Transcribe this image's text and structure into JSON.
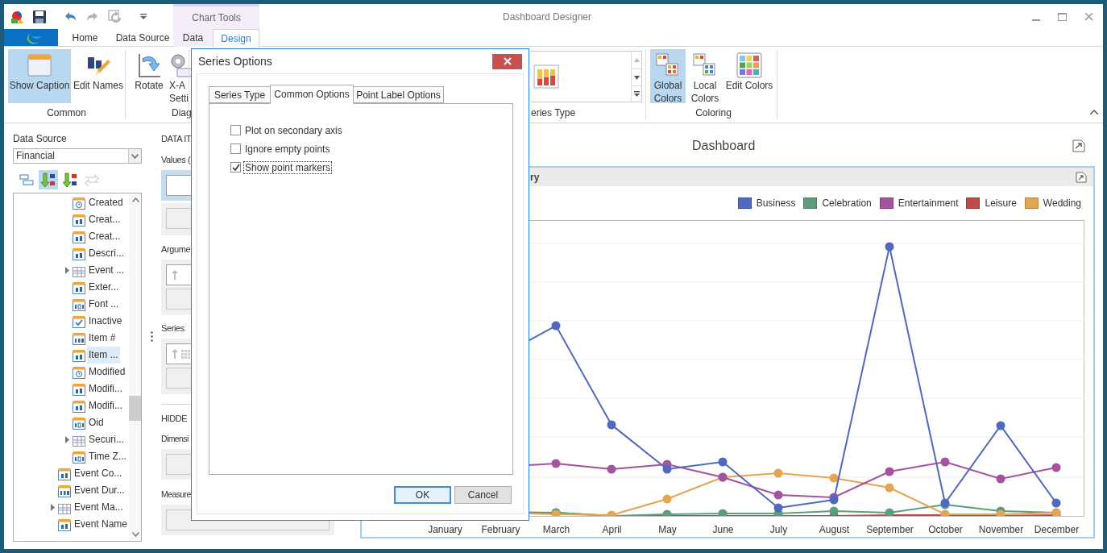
{
  "window": {
    "title": "Dashboard Designer"
  },
  "context_group": {
    "label": "Chart Tools"
  },
  "tabs": [
    {
      "label": "Home",
      "selected": false,
      "contextual": false
    },
    {
      "label": "Data Source",
      "selected": false,
      "contextual": false
    },
    {
      "label": "Data",
      "selected": false,
      "contextual": true
    },
    {
      "label": "Design",
      "selected": true,
      "contextual": true
    }
  ],
  "ribbon": [
    {
      "kind": "buttons",
      "label": "Common",
      "buttons": [
        {
          "lines": [
            "Show Caption"
          ],
          "selected": true
        },
        {
          "lines": [
            "Edit Names"
          ],
          "selected": false
        }
      ]
    },
    {
      "kind": "buttons",
      "label": "Diag",
      "buttons": [
        {
          "lines": [
            "Rotate"
          ],
          "selected": false
        },
        {
          "lines": [
            "X-A",
            "Setti"
          ],
          "selected": false
        }
      ]
    },
    {
      "kind": "gallery",
      "label": "eries Type"
    },
    {
      "kind": "buttons",
      "label": "Coloring",
      "buttons": [
        {
          "lines": [
            "Global",
            "Colors"
          ],
          "selected": true
        },
        {
          "lines": [
            "Local",
            "Colors"
          ],
          "selected": false
        },
        {
          "lines": [
            "Edit Colors"
          ],
          "selected": false
        }
      ]
    }
  ],
  "data_source": {
    "label": "Data Source",
    "value": "Financial"
  },
  "sort_buttons": [
    {
      "selected": false,
      "disabled": false
    },
    {
      "selected": true,
      "disabled": false
    },
    {
      "selected": false,
      "disabled": false
    },
    {
      "selected": false,
      "disabled": true
    }
  ],
  "field_tree": {
    "children_of_scrolled_parent": [
      {
        "label": "Created",
        "kind": "date",
        "selected": false
      },
      {
        "label": "Creat...",
        "kind": "text",
        "selected": false
      },
      {
        "label": "Creat...",
        "kind": "text",
        "selected": false
      },
      {
        "label": "Descri...",
        "kind": "text",
        "selected": false
      },
      {
        "label": "Event ...",
        "kind": "table",
        "selected": false,
        "expanded": false
      },
      {
        "label": "Exter...",
        "kind": "text",
        "selected": false
      },
      {
        "label": "Font ...",
        "kind": "number",
        "selected": false
      },
      {
        "label": "Inactive",
        "kind": "bool",
        "selected": false
      },
      {
        "label": "Item #",
        "kind": "integer",
        "selected": false
      },
      {
        "label": "Item ...",
        "kind": "text",
        "selected": true
      },
      {
        "label": "Modified",
        "kind": "date",
        "selected": false
      },
      {
        "label": "Modifi...",
        "kind": "text",
        "selected": false
      },
      {
        "label": "Modifi...",
        "kind": "text",
        "selected": false
      },
      {
        "label": "Oid",
        "kind": "number",
        "selected": false
      },
      {
        "label": "Securi...",
        "kind": "table",
        "selected": false,
        "expanded": false
      },
      {
        "label": "Time Z...",
        "kind": "number",
        "selected": false
      }
    ],
    "items": [
      {
        "label": "Event Co...",
        "kind": "text",
        "selected": false
      },
      {
        "label": "Event Dur...",
        "kind": "integer",
        "selected": false
      },
      {
        "label": "Event Ma...",
        "kind": "table",
        "selected": false,
        "expanded": false
      },
      {
        "label": "Event Name",
        "kind": "text",
        "selected": false
      }
    ]
  },
  "data_items": {
    "heading": "DATA IT",
    "zones": [
      {
        "kind": "values",
        "label": "Values (",
        "selected": true
      },
      {
        "kind": "argument",
        "label": "Argume",
        "selected": false
      },
      {
        "kind": "series",
        "label": "Series",
        "selected": false
      }
    ]
  },
  "hidden_items": {
    "heading": "HIDDE",
    "zones": [
      {
        "label": "Dimensi"
      },
      {
        "label": "Measure"
      }
    ]
  },
  "dashboard": {
    "title": "Dashboard",
    "item": {
      "caption": "ry",
      "legend": [
        {
          "label": "Business",
          "color": "#5068c0"
        },
        {
          "label": "Celebration",
          "color": "#5a9e7e"
        },
        {
          "label": "Entertainment",
          "color": "#a552a0"
        },
        {
          "label": "Leisure",
          "color": "#c04a4a"
        },
        {
          "label": "Wedding",
          "color": "#e3a552"
        }
      ],
      "x_labels": [
        "January",
        "February",
        "March",
        "April",
        "May",
        "June",
        "July",
        "August",
        "September",
        "October",
        "November",
        "December"
      ]
    }
  },
  "dialog": {
    "title": "Series Options",
    "tabs": [
      {
        "label": "Series Type",
        "selected": false
      },
      {
        "label": "Common Options",
        "selected": true
      },
      {
        "label": "Point Label Options",
        "selected": false
      }
    ],
    "options": [
      {
        "label": "Plot on secondary axis",
        "checked": false,
        "focused": false
      },
      {
        "label": "Ignore empty points",
        "checked": false,
        "focused": false
      },
      {
        "label": "Show point markers",
        "checked": true,
        "focused": true
      }
    ],
    "buttons": [
      {
        "label": "OK",
        "default": true
      },
      {
        "label": "Cancel",
        "default": false
      }
    ]
  }
}
